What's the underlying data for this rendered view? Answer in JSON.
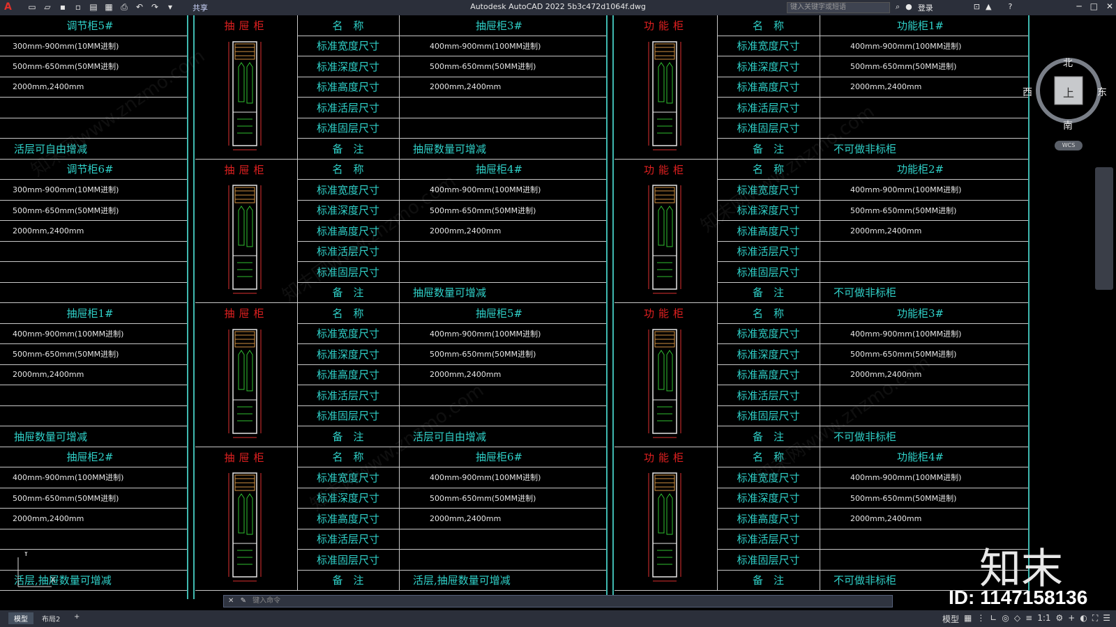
{
  "window": {
    "title": "Autodesk AutoCAD 2022    5b3c472d1064f.dwg",
    "search_placeholder": "键入关键字或短语",
    "login_label": "登录",
    "share_label": "共享",
    "app_icon": "A"
  },
  "field_labels": {
    "name": "名　称",
    "width": "标准宽度尺寸",
    "depth": "标准深度尺寸",
    "height": "标准高度尺寸",
    "adj_shelf": "标准活层尺寸",
    "fix_shelf": "标准固层尺寸",
    "note": "备　注"
  },
  "left_column": [
    {
      "title": "调节柜5#",
      "width": "300mm-900mm(10MM进制)",
      "depth": "500mm-650mm(50MM进制)",
      "height": "2000mm,2400mm",
      "note": "活层可自由增减"
    },
    {
      "title": "调节柜6#",
      "width": "300mm-900mm(10MM进制)",
      "depth": "500mm-650mm(50MM进制)",
      "height": "2000mm,2400mm",
      "note": ""
    },
    {
      "title": "抽屉柜1#",
      "width": "400mm-900mm(100MM进制)",
      "depth": "500mm-650mm(50MM进制)",
      "height": "2000mm,2400mm",
      "note": "抽屉数量可增减"
    },
    {
      "title": "抽屉柜2#",
      "width": "400mm-900mm(100MM进制)",
      "depth": "500mm-650mm(50MM进制)",
      "height": "2000mm,2400mm",
      "note": "活层,抽屉数量可增减"
    }
  ],
  "middle_column": [
    {
      "category": "抽屉柜",
      "title": "抽屉柜3#",
      "width": "400mm-900mm(100MM进制)",
      "depth": "500mm-650mm(50MM进制)",
      "height": "2000mm,2400mm",
      "note": "抽屉数量可增减"
    },
    {
      "category": "抽屉柜",
      "title": "抽屉柜4#",
      "width": "400mm-900mm(100MM进制)",
      "depth": "500mm-650mm(50MM进制)",
      "height": "2000mm,2400mm",
      "note": "抽屉数量可增减"
    },
    {
      "category": "抽屉柜",
      "title": "抽屉柜5#",
      "width": "400mm-900mm(100MM进制)",
      "depth": "500mm-650mm(50MM进制)",
      "height": "2000mm,2400mm",
      "note": "活层可自由增减"
    },
    {
      "category": "抽屉柜",
      "title": "抽屉柜6#",
      "width": "400mm-900mm(100MM进制)",
      "depth": "500mm-650mm(50MM进制)",
      "height": "2000mm,2400mm",
      "note": "活层,抽屉数量可增减"
    }
  ],
  "right_column": [
    {
      "category": "功能柜",
      "title": "功能柜1#",
      "width": "400mm-900mm(100MM进制)",
      "depth": "500mm-650mm(50MM进制)",
      "height": "2000mm,2400mm",
      "note": "不可做非标柜"
    },
    {
      "category": "功能柜",
      "title": "功能柜2#",
      "width": "400mm-900mm(100MM进制)",
      "depth": "500mm-650mm(50MM进制)",
      "height": "2000mm,2400mm",
      "note": "不可做非标柜"
    },
    {
      "category": "功能柜",
      "title": "功能柜3#",
      "width": "400mm-900mm(100MM进制)",
      "depth": "500mm-650mm(50MM进制)",
      "height": "2000mm,2400mm",
      "note": "不可做非标柜"
    },
    {
      "category": "功能柜",
      "title": "功能柜4#",
      "width": "400mm-900mm(100MM进制)",
      "depth": "500mm-650mm(50MM进制)",
      "height": "2000mm,2400mm",
      "note": "不可做非标柜"
    }
  ],
  "viewcube": {
    "north": "北",
    "south": "南",
    "east": "东",
    "west": "西",
    "top": "上",
    "wcs": "WCS"
  },
  "command_placeholder": "键入命令",
  "tabs": [
    "模型",
    "布局2"
  ],
  "status": {
    "model_label": "模型",
    "scale": "1:1"
  },
  "watermark": {
    "logo": "知末",
    "id": "ID: 1147158136",
    "site": "知末网www.znzmo.com"
  },
  "colors": {
    "text": "#2fd0c8",
    "category": "#e02020",
    "divider": "#3fb9b0",
    "background": "#000000"
  }
}
